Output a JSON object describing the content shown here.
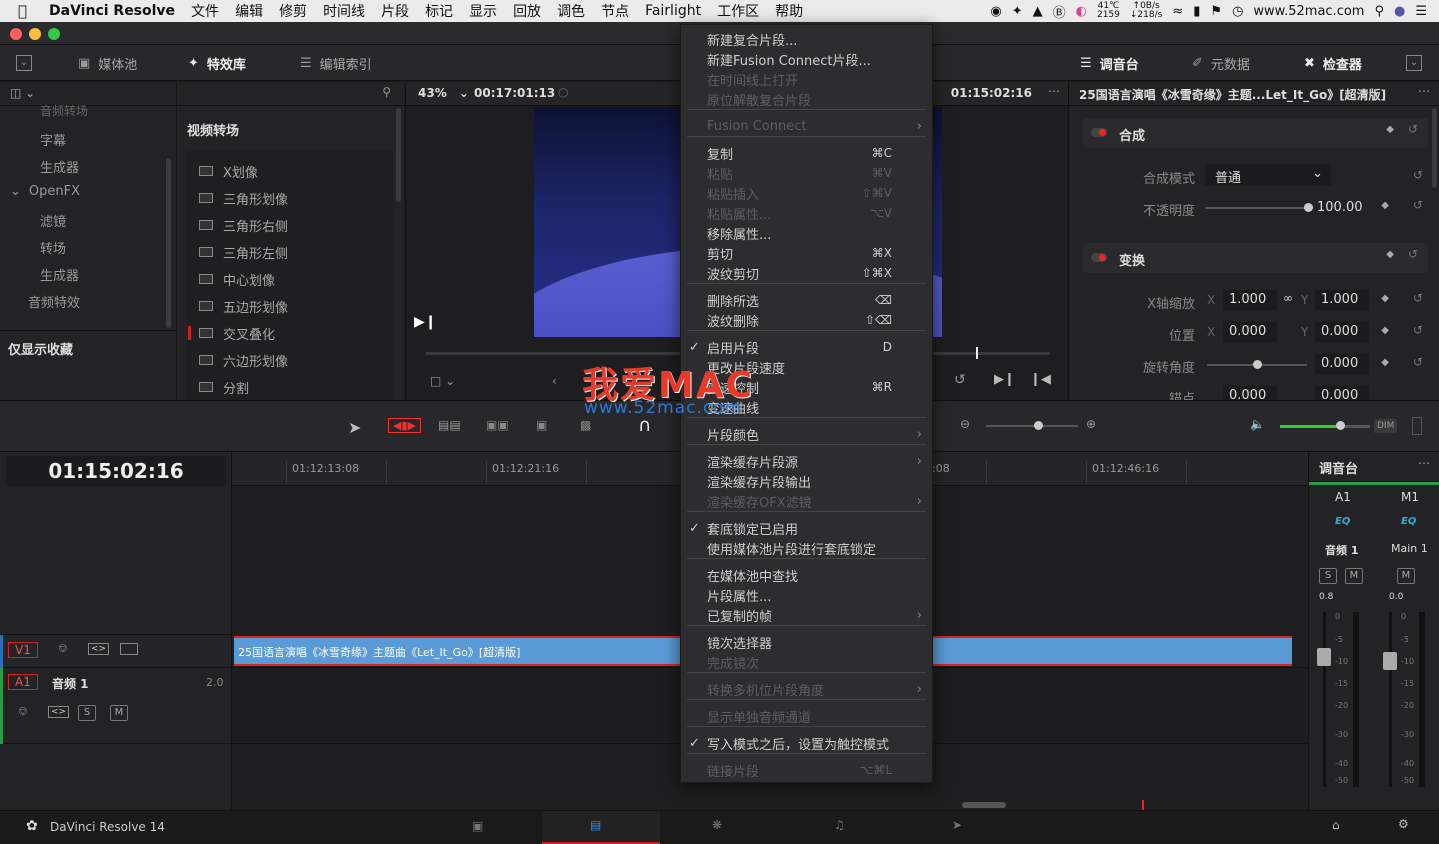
{
  "menubar": {
    "items": [
      "文件",
      "编辑",
      "修剪",
      "时间线",
      "片段",
      "标记",
      "显示",
      "回放",
      "调色",
      "节点",
      "Fairlight",
      "工作区",
      "帮助"
    ],
    "app_name": "DaVinci Resolve",
    "cpu_temp": "41℃",
    "cpu_rpm": "2159",
    "net_up": "↑0B/s",
    "net_down": "↓218/s",
    "url_text": "www.52mac.com"
  },
  "toolbar": {
    "media_pool": "媒体池",
    "effects_library": "特效库",
    "edit_index": "编辑索引",
    "mixer": "调音台",
    "metadata": "元数据",
    "inspector": "检查器"
  },
  "left_tree": {
    "items": [
      "音频转场",
      "字幕",
      "生成器",
      "OpenFX",
      "滤镜",
      "转场",
      "生成器",
      "音频特效"
    ],
    "favorites": "仅显示收藏"
  },
  "browser": {
    "title": "视频转场",
    "items": [
      "X划像",
      "三角形划像",
      "三角形右侧",
      "三角形左侧",
      "中心划像",
      "五边形划像",
      "交叉叠化",
      "六边形划像",
      "分割"
    ]
  },
  "viewer": {
    "zoom": "43%",
    "source_timecode": "00:17:01:13",
    "record_timecode": "01:15:02:16"
  },
  "inspector": {
    "clip_title": "25国语言演唱《冰雪奇缘》主题...Let_It_Go》[超清版]",
    "composite_header": "合成",
    "composite_mode_label": "合成模式",
    "composite_mode_value": "普通",
    "opacity_label": "不透明度",
    "opacity_value": "100.00",
    "transform_header": "变换",
    "zoom_label": "X轴缩放",
    "zoom_x": "1.000",
    "zoom_y": "1.000",
    "position_label": "位置",
    "pos_x": "0.000",
    "pos_y": "0.000",
    "rotation_label": "旋转角度",
    "rotation_value": "0.000",
    "anchor_label": "锚点",
    "anchor_x": "0.000",
    "anchor_y": "0.000",
    "x": "X",
    "y": "Y"
  },
  "timeline": {
    "timecode": "01:15:02:16",
    "ruler": [
      "01:12:13:08",
      "01:12:21:16",
      ":08",
      "01:12:46:16"
    ],
    "v1": "V1",
    "a1": "A1",
    "audio_track_name": "音频 1",
    "audio_track_level": "2.0",
    "clip_name": "25国语言演唱《冰雪奇缘》主题曲《Let_It_Go》[超清版]",
    "dim": "DIM",
    "s": "S",
    "m": "M"
  },
  "mixer": {
    "title": "调音台",
    "ch1": "A1",
    "ch2": "M1",
    "eq": "EQ",
    "track1": "音频 1",
    "track2": "Main 1",
    "level1": "0.8",
    "level2": "0.0",
    "scale": [
      "0",
      "-5",
      "-10",
      "-15",
      "-20",
      "-30",
      "-40",
      "-50"
    ]
  },
  "bottom": {
    "app_version": "DaVinci Resolve 14"
  },
  "context_menu": {
    "items": [
      {
        "label": "新建复合片段...",
        "shortcut": "",
        "disabled": false
      },
      {
        "label": "新建Fusion Connect片段...",
        "shortcut": "",
        "disabled": false
      },
      {
        "label": "在时间线上打开",
        "shortcut": "",
        "disabled": true
      },
      {
        "label": "原位解散复合片段",
        "shortcut": "",
        "disabled": true
      },
      {
        "label": "Fusion Connect",
        "shortcut": "",
        "disabled": true
      },
      {
        "label": "复制",
        "shortcut": "⌘C",
        "disabled": false
      },
      {
        "label": "粘贴",
        "shortcut": "⌘V",
        "disabled": true
      },
      {
        "label": "粘贴插入",
        "shortcut": "⇧⌘V",
        "disabled": true
      },
      {
        "label": "粘贴属性...",
        "shortcut": "⌥V",
        "disabled": true
      },
      {
        "label": "移除属性...",
        "shortcut": "",
        "disabled": false
      },
      {
        "label": "剪切",
        "shortcut": "⌘X",
        "disabled": false
      },
      {
        "label": "波纹剪切",
        "shortcut": "⇧⌘X",
        "disabled": false
      },
      {
        "label": "删除所选",
        "shortcut": "⌫",
        "disabled": false
      },
      {
        "label": "波纹删除",
        "shortcut": "⇧⌫",
        "disabled": false
      },
      {
        "label": "启用片段",
        "shortcut": "D",
        "disabled": false
      },
      {
        "label": "更改片段速度",
        "shortcut": "",
        "disabled": false
      },
      {
        "label": "变速控制",
        "shortcut": "⌘R",
        "disabled": false
      },
      {
        "label": "变速曲线",
        "shortcut": "",
        "disabled": false
      },
      {
        "label": "片段颜色",
        "shortcut": "",
        "disabled": false
      },
      {
        "label": "渲染缓存片段源",
        "shortcut": "",
        "disabled": false
      },
      {
        "label": "渲染缓存片段输出",
        "shortcut": "",
        "disabled": false
      },
      {
        "label": "渲染缓存OFX滤镜",
        "shortcut": "",
        "disabled": true
      },
      {
        "label": "套底锁定已启用",
        "shortcut": "",
        "disabled": false
      },
      {
        "label": "使用媒体池片段进行套底锁定",
        "shortcut": "",
        "disabled": false
      },
      {
        "label": "在媒体池中查找",
        "shortcut": "",
        "disabled": false
      },
      {
        "label": "片段属性...",
        "shortcut": "",
        "disabled": false
      },
      {
        "label": "已复制的帧",
        "shortcut": "",
        "disabled": false
      },
      {
        "label": "镜次选择器",
        "shortcut": "",
        "disabled": false
      },
      {
        "label": "完成镜次",
        "shortcut": "",
        "disabled": true
      },
      {
        "label": "转换多机位片段角度",
        "shortcut": "",
        "disabled": true
      },
      {
        "label": "显示单独音频通道",
        "shortcut": "",
        "disabled": true
      },
      {
        "label": "写入模式之后，设置为触控模式",
        "shortcut": "",
        "disabled": false
      },
      {
        "label": "链接片段",
        "shortcut": "⌥⌘L",
        "disabled": true
      }
    ]
  },
  "watermark": {
    "line1": "我爱MAC",
    "line2": "www.52mac.com"
  }
}
